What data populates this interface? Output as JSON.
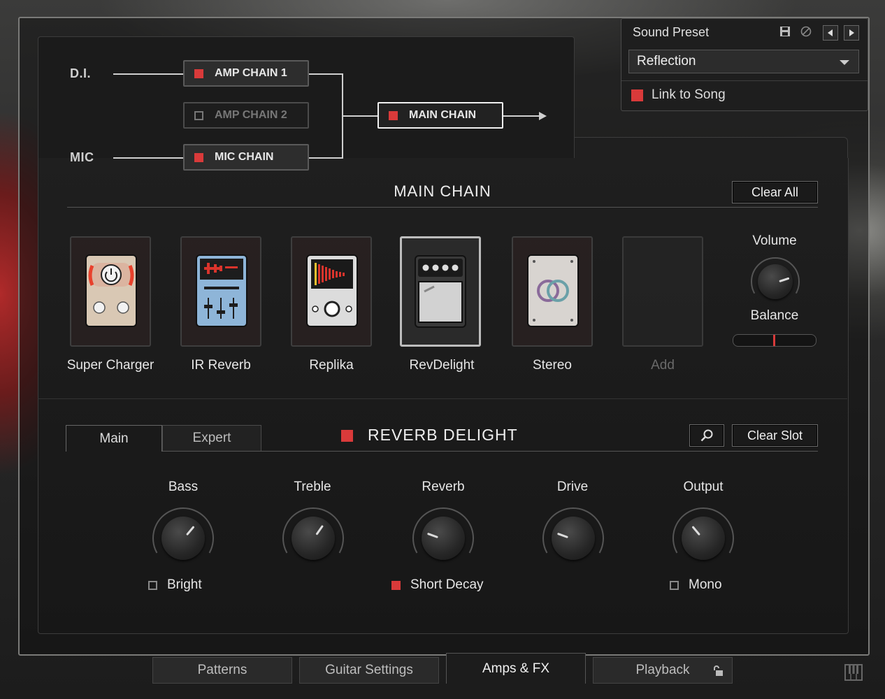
{
  "routing": {
    "di_label": "D.I.",
    "mic_label": "MIC",
    "amp_chain_1": "AMP CHAIN 1",
    "amp_chain_2": "AMP CHAIN 2",
    "mic_chain": "MIC CHAIN",
    "main_chain": "MAIN CHAIN"
  },
  "preset": {
    "title": "Sound Preset",
    "value": "Reflection",
    "link_label": "Link to Song",
    "link_enabled": true,
    "icons": [
      "save-icon",
      "disable-icon",
      "previous-icon",
      "next-icon"
    ]
  },
  "main_chain": {
    "title": "MAIN CHAIN",
    "clear_all": "Clear All",
    "slots": [
      {
        "label": "Super Charger",
        "icon": "supercharger-pedal-icon"
      },
      {
        "label": "IR Reverb",
        "icon": "ir-reverb-pedal-icon"
      },
      {
        "label": "Replika",
        "icon": "replika-pedal-icon"
      },
      {
        "label": "RevDelight",
        "icon": "revdelight-pedal-icon",
        "selected": true
      },
      {
        "label": "Stereo",
        "icon": "stereo-pedal-icon"
      },
      {
        "label": "Add",
        "icon": "empty-slot"
      }
    ],
    "volume_label": "Volume",
    "balance_label": "Balance"
  },
  "effect": {
    "tabs": [
      "Main",
      "Expert"
    ],
    "active_tab": "Main",
    "title": "REVERB DELIGHT",
    "clear_slot": "Clear Slot",
    "knobs": [
      {
        "label": "Bass"
      },
      {
        "label": "Treble"
      },
      {
        "label": "Reverb"
      },
      {
        "label": "Drive"
      },
      {
        "label": "Output"
      }
    ],
    "toggles": [
      {
        "label": "Bright",
        "checked": false
      },
      {
        "label": "Short Decay",
        "checked": true
      },
      {
        "label": "Mono",
        "checked": false
      }
    ]
  },
  "bottom_tabs": [
    "Patterns",
    "Guitar Settings",
    "Amps & FX",
    "Playback"
  ],
  "active_bottom_tab": "Amps & FX",
  "colors": {
    "accent_red": "#d93a3a",
    "panel": "#1b1b1b"
  }
}
